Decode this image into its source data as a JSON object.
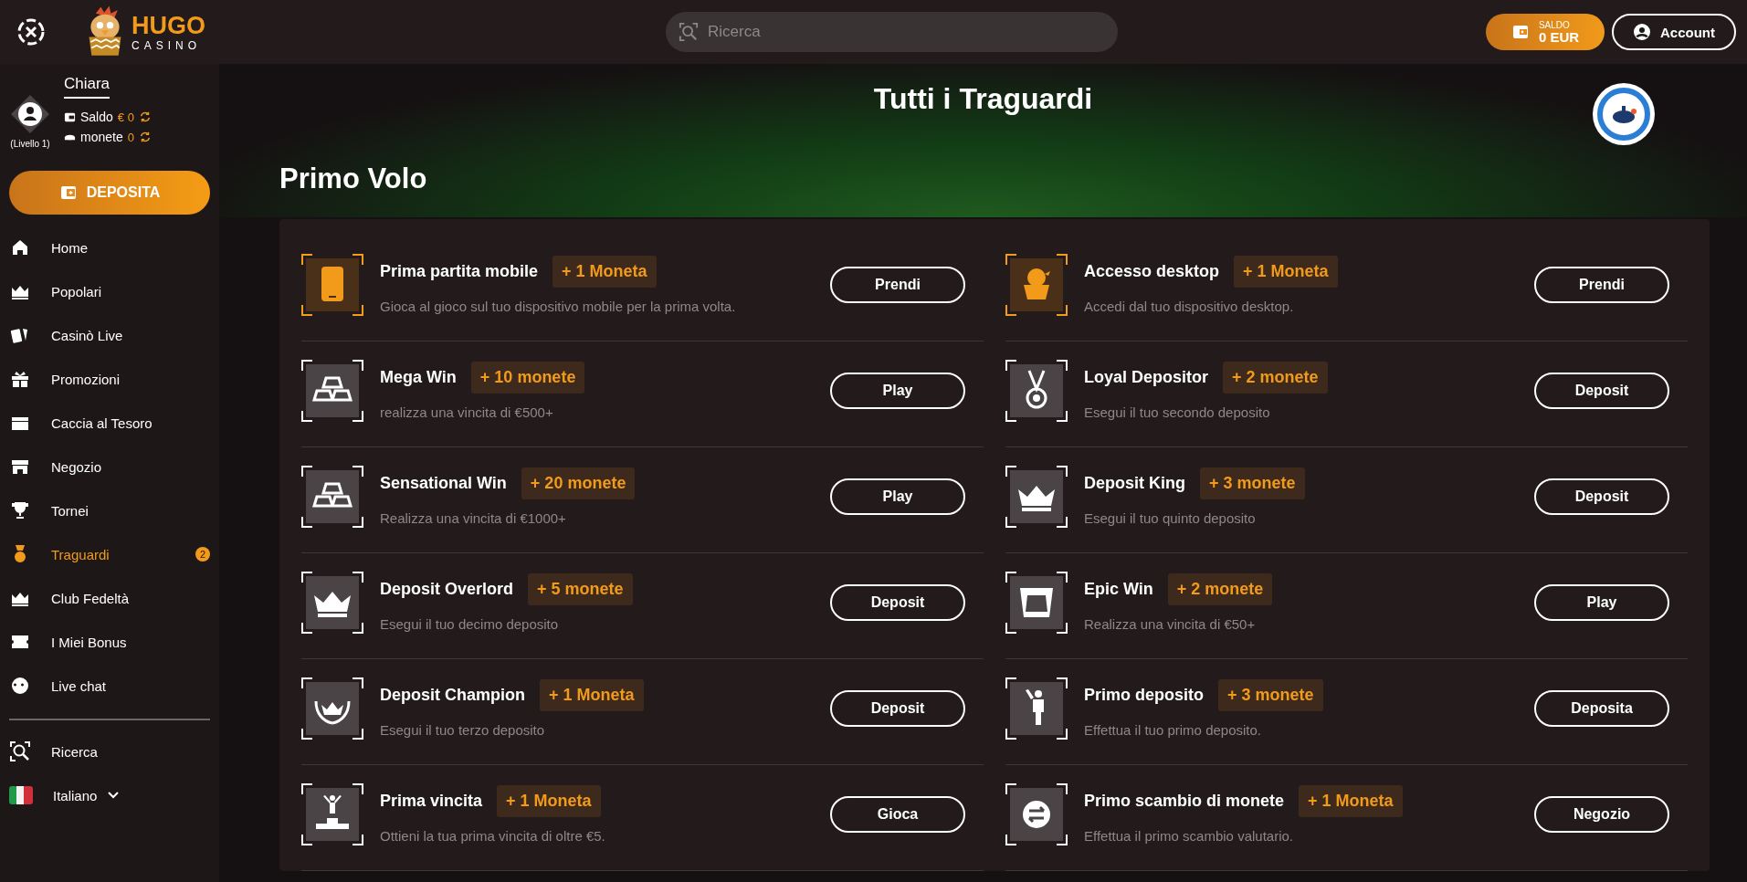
{
  "header": {
    "logo": {
      "word": "HUGO",
      "sub": "CASINO"
    },
    "search": {
      "placeholder": "Ricerca"
    },
    "balance": {
      "label": "SALDO",
      "value": "0 EUR"
    },
    "account": "Account"
  },
  "profile": {
    "name": "Chiara",
    "level": "(Livello 1)",
    "saldo_label": "Saldo",
    "saldo_value": "€ 0",
    "coins_label": "monete",
    "coins_value": "0"
  },
  "deposit_button": "DEPOSITA",
  "nav": [
    {
      "label": "Home",
      "kind": "home",
      "selected": false
    },
    {
      "label": "Popolari",
      "kind": "crown",
      "selected": false
    },
    {
      "label": "Casinò Live",
      "kind": "cards",
      "selected": false
    },
    {
      "label": "Promozioni",
      "kind": "gift",
      "selected": false
    },
    {
      "label": "Caccia al Tesoro",
      "kind": "chest",
      "selected": false
    },
    {
      "label": "Negozio",
      "kind": "shop",
      "selected": false
    },
    {
      "label": "Tornei",
      "kind": "trophy",
      "selected": false
    },
    {
      "label": "Traguardi",
      "kind": "medal",
      "selected": true,
      "badge": "2"
    },
    {
      "label": "Club Fedeltà",
      "kind": "crown",
      "selected": false
    },
    {
      "label": "I Miei Bonus",
      "kind": "ticket",
      "selected": false
    },
    {
      "label": "Live chat",
      "kind": "chat",
      "selected": false
    }
  ],
  "nav_bottom": [
    {
      "label": "Ricerca",
      "kind": "search"
    },
    {
      "label": "Italiano",
      "kind": "flag"
    }
  ],
  "page": {
    "title": "Tutti i Traguardi",
    "section": "Primo Volo"
  },
  "achievements": [
    {
      "title": "Prima partita mobile",
      "reward": "+ 1 Moneta",
      "description": "Gioca al gioco sul tuo dispositivo mobile per la prima volta.",
      "button": "Prendi",
      "kind": "mobile",
      "completed": true
    },
    {
      "title": "Accesso desktop",
      "reward": "+ 1 Moneta",
      "description": "Accedi dal tuo dispositivo desktop.",
      "button": "Prendi",
      "kind": "chick",
      "completed": true
    },
    {
      "title": "Mega Win",
      "reward": "+ 10 monete",
      "description": "realizza una vincita di €500+",
      "button": "Play",
      "kind": "bars",
      "completed": false
    },
    {
      "title": "Loyal Depositor",
      "reward": "+ 2 monete",
      "description": "Esegui il tuo secondo deposito",
      "button": "Deposit",
      "kind": "medal",
      "completed": false
    },
    {
      "title": "Sensational Win",
      "reward": "+ 20 monete",
      "description": "Realizza una vincita di €1000+",
      "button": "Play",
      "kind": "bars",
      "completed": false
    },
    {
      "title": "Deposit King",
      "reward": "+ 3 monete",
      "description": "Esegui il tuo quinto deposito",
      "button": "Deposit",
      "kind": "crown",
      "completed": false
    },
    {
      "title": "Deposit Overlord",
      "reward": "+ 5 monete",
      "description": "Esegui il tuo decimo deposito",
      "button": "Deposit",
      "kind": "crown",
      "completed": false
    },
    {
      "title": "Epic Win",
      "reward": "+ 2 monete",
      "description": "Realizza una vincita di €50+",
      "button": "Play",
      "kind": "card",
      "completed": false
    },
    {
      "title": "Deposit Champion",
      "reward": "+ 1 Moneta",
      "description": "Esegui il tuo terzo deposito",
      "button": "Deposit",
      "kind": "wreath",
      "completed": false
    },
    {
      "title": "Primo deposito",
      "reward": "+ 3 monete",
      "description": "Effettua il tuo primo deposito.",
      "button": "Deposita",
      "kind": "person",
      "completed": false
    },
    {
      "title": "Prima vincita",
      "reward": "+ 1 Moneta",
      "description": "Ottieni la tua prima vincita di oltre €5.",
      "button": "Gioca",
      "kind": "podium",
      "completed": false
    },
    {
      "title": "Primo scambio di monete",
      "reward": "+ 1 Moneta",
      "description": "Effettua il primo scambio valutario.",
      "button": "Negozio",
      "kind": "exchange",
      "completed": false
    }
  ]
}
